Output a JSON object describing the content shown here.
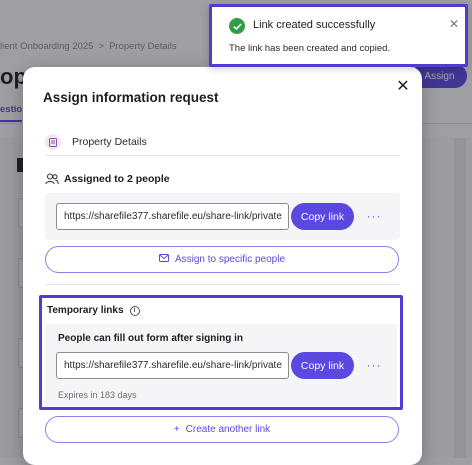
{
  "background": {
    "breadcrumb": [
      "lient Onboarding 2025",
      "Property Details"
    ],
    "breadcrumb_sep": ">",
    "title": "op",
    "tab_active": "estio",
    "assign_button": "Assign"
  },
  "modal": {
    "title": "Assign information request",
    "close_icon": "close-icon",
    "template_name": "Property Details",
    "assigned_label": "Assigned to 2 people",
    "assigned_link": "https://sharefile377.sharefile.eu/share-link/private",
    "copy_label": "Copy link",
    "more_label": "···",
    "assign_specific_label": "Assign to specific people",
    "temporary": {
      "label": "Temporary links",
      "subtitle": "People can fill out form after signing in",
      "link": "https://sharefile377.sharefile.eu/share-link/private",
      "copy_label": "Copy link",
      "expires": "Expires in 183 days"
    },
    "create_another_label": "Create another link",
    "create_another_icon": "+"
  },
  "toast": {
    "title": "Link created successfully",
    "message": "The link has been created and copied.",
    "status_color": "#2f9e44"
  },
  "colors": {
    "accent": "#5b48e0",
    "highlight_frame": "#4f3cd3"
  }
}
